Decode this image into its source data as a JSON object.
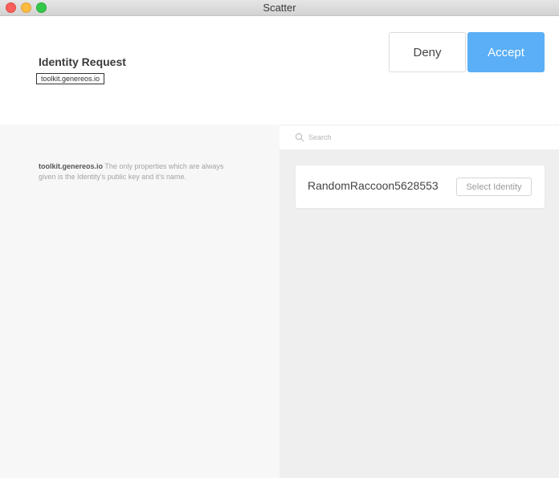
{
  "window": {
    "title": "Scatter"
  },
  "header": {
    "title": "Identity Request",
    "origin": "toolkit.genereos.io",
    "deny_label": "Deny",
    "accept_label": "Accept"
  },
  "description": {
    "origin": "toolkit.genereos.io",
    "text": "The only properties which are always given is the Identity's public key and it's name."
  },
  "search": {
    "placeholder": "Search",
    "icon": "search-icon"
  },
  "identities": [
    {
      "name": "RandomRaccoon5628553",
      "select_label": "Select Identity"
    }
  ],
  "colors": {
    "accent": "#5aaff6",
    "left_panel_bg": "#f7f7f7",
    "right_panel_bg": "#efefef"
  }
}
